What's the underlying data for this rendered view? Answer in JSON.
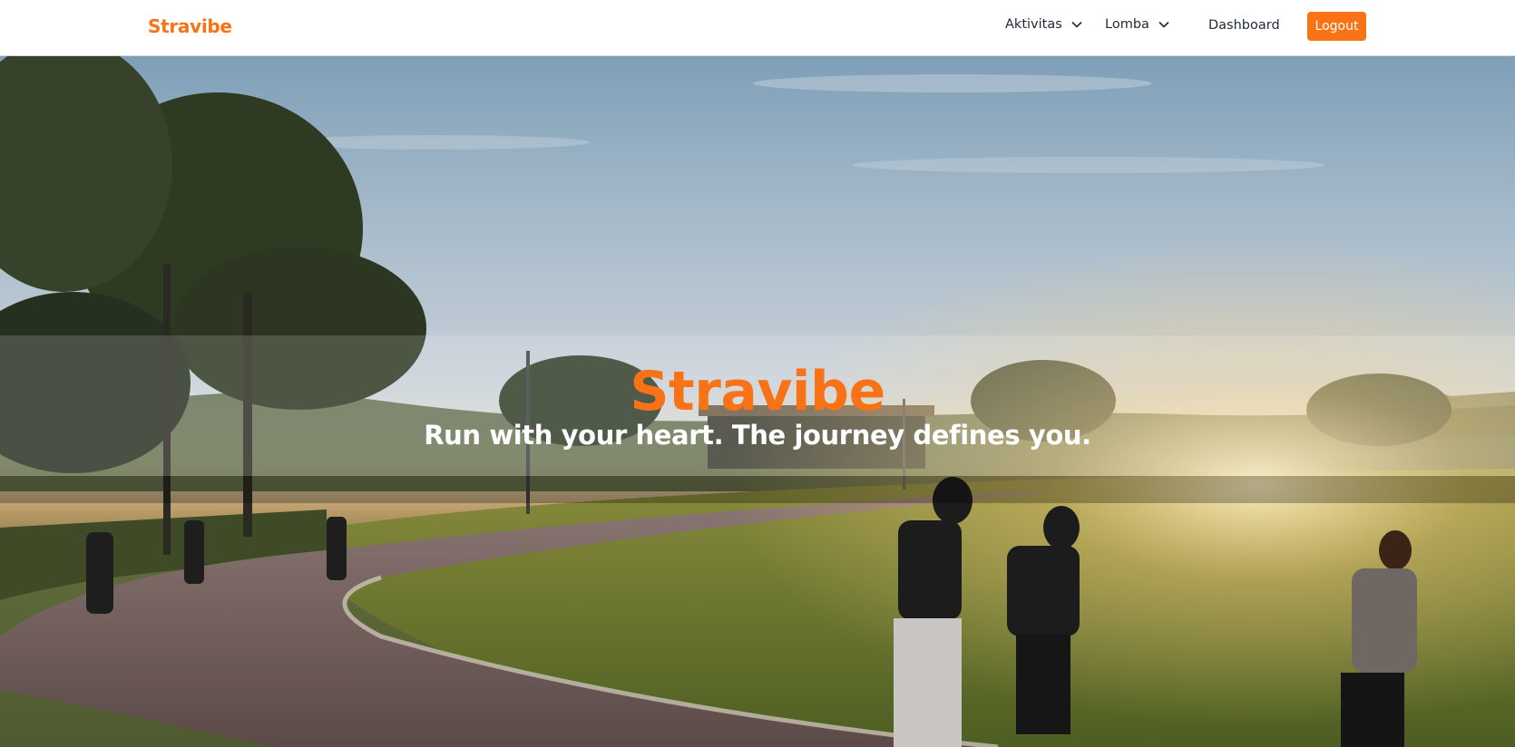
{
  "nav": {
    "brand": "Stravibe",
    "items": [
      {
        "label": "Aktivitas",
        "icon": "chevron-down-icon"
      },
      {
        "label": "Lomba",
        "icon": "chevron-down-icon"
      }
    ],
    "dashboard_label": "Dashboard",
    "logout_label": "Logout"
  },
  "hero": {
    "title": "Stravibe",
    "tagline": "Run with your heart. The journey defines you."
  },
  "colors": {
    "accent": "#f97316",
    "nav_text": "#1f2937",
    "hero_text": "#ffffff"
  }
}
